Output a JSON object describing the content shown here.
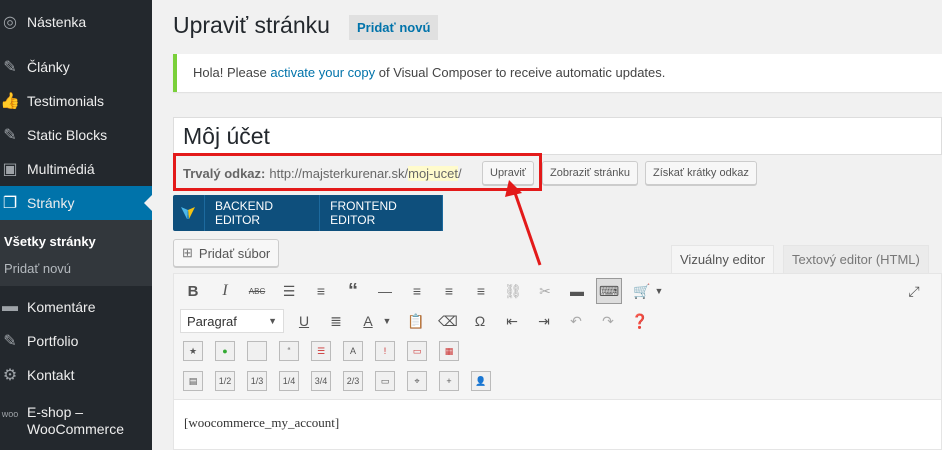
{
  "sidebar": {
    "items": [
      {
        "label": "Nástenka",
        "icon": "dashboard-icon"
      },
      {
        "label": "Články",
        "icon": "pin-icon"
      },
      {
        "label": "Testimonials",
        "icon": "thumbs-up-icon"
      },
      {
        "label": "Static Blocks",
        "icon": "pin-icon"
      },
      {
        "label": "Multimédiá",
        "icon": "media-icon"
      },
      {
        "label": "Stránky",
        "icon": "pages-icon"
      },
      {
        "label": "Komentáre",
        "icon": "comment-icon"
      },
      {
        "label": "Portfolio",
        "icon": "pin-icon"
      },
      {
        "label": "Kontakt",
        "icon": "gear-icon"
      },
      {
        "label": "E-shop –",
        "label2": "WooCommerce",
        "icon": "woo-icon"
      }
    ],
    "submenu": [
      "Všetky stránky",
      "Pridať novú"
    ]
  },
  "header": {
    "title": "Upraviť stránku",
    "add_new": "Pridať novú"
  },
  "notice": {
    "before": "Hola! Please",
    "link": "activate your copy",
    "after": "of Visual Composer to receive automatic updates."
  },
  "post_title": "Môj účet",
  "permalink": {
    "label": "Trvalý odkaz:",
    "url": "http://majsterkurenar.sk/",
    "slug": "moj-ucet",
    "trail": "/",
    "edit": "Upraviť",
    "view": "Zobraziť stránku",
    "shortlink": "Získať krátky odkaz"
  },
  "vc": {
    "backend": "BACKEND EDITOR",
    "frontend": "FRONTEND EDITOR"
  },
  "add_media": "Pridať súbor",
  "tabs": {
    "visual": "Vizuálny editor",
    "text": "Textový editor (HTML)"
  },
  "toolbar": {
    "format": "Paragraf",
    "fractions": [
      "1/2",
      "1/3",
      "1/4",
      "3/4",
      "2/3"
    ]
  },
  "content": "[woocommerce_my_account]",
  "colors": {
    "sidebar": "#23282d",
    "active": "#0073aa",
    "highlight": "#e31a1a",
    "vc": "#0e4f7c"
  }
}
